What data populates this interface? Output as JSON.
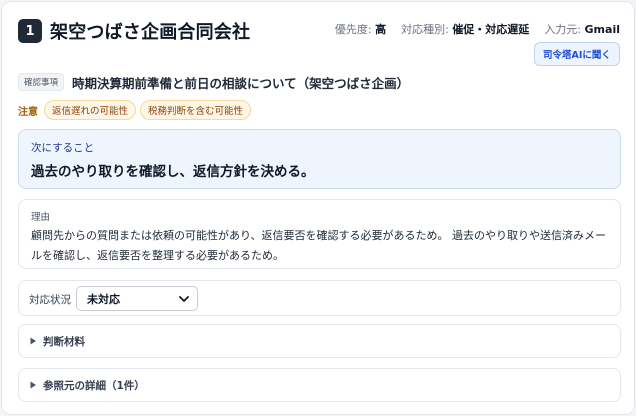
{
  "header": {
    "number": "1",
    "company": "架空つばさ企画合同会社",
    "priority_label": "優先度:",
    "priority_value": "高",
    "type_label": "対応種別:",
    "type_value": "催促・対応遅延",
    "source_label": "入力元:",
    "source_value": "Gmail",
    "ask_ai_button": "司令塔AIに聞く"
  },
  "subject": {
    "tag": "確認事項",
    "text": "時期決算期前準備と前日の相談について（架空つばさ企画）"
  },
  "notes": {
    "label": "注意",
    "chips": [
      "返信遅れの可能性",
      "税務判断を含む可能性"
    ]
  },
  "next_action": {
    "label": "次にすること",
    "text": "過去のやり取りを確認し、返信方針を決める。"
  },
  "reason": {
    "label": "理由",
    "text": "顧問先からの質問または依頼の可能性があり、返信要否を確認する必要があるため。 過去のやり取りや送信済みメールを確認し、返信要否を整理する必要があるため。"
  },
  "status": {
    "label": "対応状況",
    "selected": "未対応"
  },
  "sections": [
    {
      "label": "判断材料"
    },
    {
      "label": "参照元の詳細（1件）"
    }
  ],
  "colors": {
    "accent": "#1d4ed8",
    "badge_bg": "#1f2a37",
    "note_text": "#92400e",
    "next_bg": "#eff5fd"
  }
}
